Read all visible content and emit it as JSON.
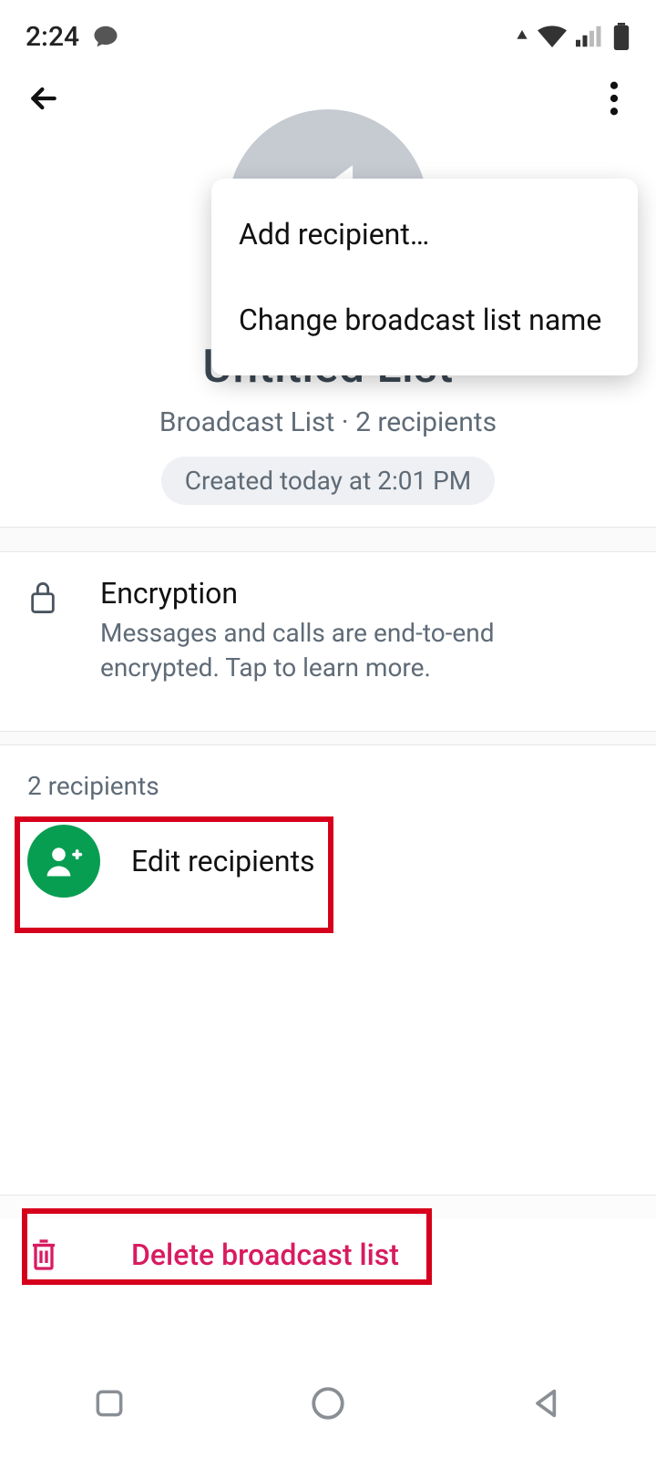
{
  "status": {
    "time": "2:24"
  },
  "menu": {
    "items": [
      {
        "label": "Add recipient…"
      },
      {
        "label": "Change broadcast list name"
      }
    ]
  },
  "header": {
    "list_title": "Untitled List",
    "subtitle": "Broadcast List · 2 recipients",
    "created": "Created today at 2:01 PM"
  },
  "encryption": {
    "title": "Encryption",
    "subtitle": "Messages and calls are end-to-end encrypted. Tap to learn more."
  },
  "recipients": {
    "header": "2 recipients",
    "edit_label": "Edit recipients"
  },
  "delete": {
    "label": "Delete broadcast list"
  },
  "colors": {
    "accent_green": "#089e52",
    "danger": "#d81b60",
    "highlight": "#d6001c"
  }
}
